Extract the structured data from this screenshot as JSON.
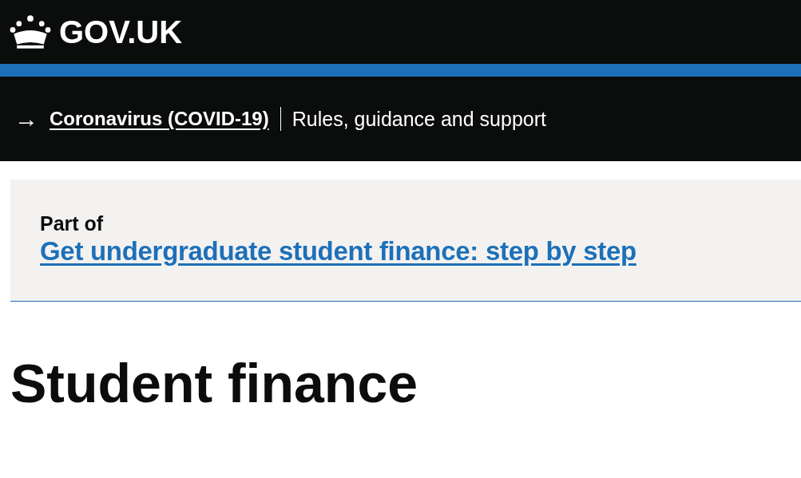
{
  "header": {
    "logo_text": "GOV.UK"
  },
  "covid_banner": {
    "arrow": "→",
    "link": "Coronavirus (COVID-19)",
    "description": "Rules, guidance and support"
  },
  "part_of": {
    "label": "Part of",
    "link": "Get undergraduate student finance: step by step"
  },
  "title": "Student finance"
}
